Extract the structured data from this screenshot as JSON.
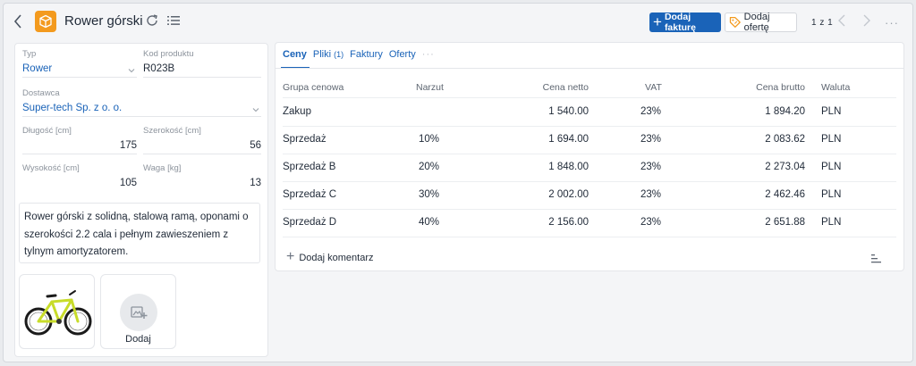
{
  "header": {
    "title": "Rower górski",
    "add_invoice_label": "Dodaj fakturę",
    "add_offer_label": "Dodaj ofertę",
    "pager": "1 z 1"
  },
  "details": {
    "type_label": "Typ",
    "type_value": "Rower",
    "code_label": "Kod produktu",
    "code_value": "R023B",
    "supplier_label": "Dostawca",
    "supplier_value": "Super-tech Sp. z o. o.",
    "length_label": "Długość [cm]",
    "length_value": "175",
    "width_label": "Szerokość [cm]",
    "width_value": "56",
    "height_label": "Wysokość [cm]",
    "height_value": "105",
    "weight_label": "Waga [kg]",
    "weight_value": "13",
    "description": "Rower górski z solidną, stalową ramą, oponami o szerokości 2.2 cala i pełnym zawieszeniem z tylnym amortyzatorem.",
    "add_image_label": "Dodaj"
  },
  "tabs": [
    {
      "label": "Ceny",
      "count": ""
    },
    {
      "label": "Pliki",
      "count": "(1)"
    },
    {
      "label": "Faktury",
      "count": ""
    },
    {
      "label": "Oferty",
      "count": ""
    }
  ],
  "table": {
    "headers": [
      "Grupa cenowa",
      "Narzut",
      "Cena netto",
      "VAT",
      "Cena brutto",
      "Waluta"
    ],
    "rows": [
      [
        "Zakup",
        "",
        "1 540.00",
        "23%",
        "1 894.20",
        "PLN"
      ],
      [
        "Sprzedaż",
        "10%",
        "1 694.00",
        "23%",
        "2 083.62",
        "PLN"
      ],
      [
        "Sprzedaż B",
        "20%",
        "1 848.00",
        "23%",
        "2 273.04",
        "PLN"
      ],
      [
        "Sprzedaż C",
        "30%",
        "2 002.00",
        "23%",
        "2 462.46",
        "PLN"
      ],
      [
        "Sprzedaż D",
        "40%",
        "2 156.00",
        "23%",
        "2 651.88",
        "PLN"
      ]
    ]
  },
  "comment": {
    "add_label": "Dodaj komentarz"
  },
  "colors": {
    "accent": "#1a63b8",
    "product_icon": "#f39a1e",
    "bike_frame": "#c8dc2a"
  }
}
